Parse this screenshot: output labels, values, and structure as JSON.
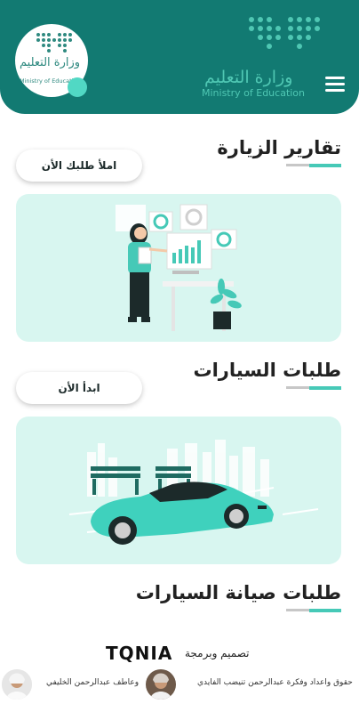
{
  "header": {
    "logo_ar": "وزارة التعليم",
    "logo_en": "Ministry of Education",
    "badge_ar": "وزارة التعليم",
    "badge_en": "Ministry of Education",
    "menu_icon": "hamburger-menu-icon",
    "colors": {
      "background": "#127a72",
      "accent": "#51d8c4"
    }
  },
  "sections": [
    {
      "title": "تقارير الزيارة",
      "button_label": "املأ طلبك الأن",
      "illustration": "report-analytics-illustration"
    },
    {
      "title": "طلبات السيارات",
      "button_label": "ابدأ الأن",
      "illustration": "car-illustration"
    },
    {
      "title": "طلبات صيانة السيارات"
    }
  ],
  "footer": {
    "design_label": "تصميم وبرمجة",
    "brand": "TQNIA",
    "credit_right": "حقوق واعداد وفكرة عبدالرحمن تنيضب الفايدي",
    "credit_left": "وعاطف عبدالرحمن الخليفي"
  }
}
